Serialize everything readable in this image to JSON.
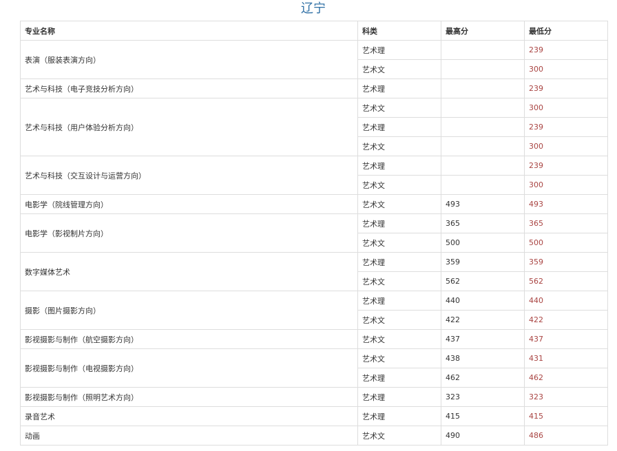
{
  "page_title": "辽宁",
  "table": {
    "headers": {
      "name": "专业名称",
      "category": "科类",
      "max": "最高分",
      "min": "最低分"
    },
    "rows": [
      {
        "name": "表演（服装表演方向）",
        "rowspan": 2,
        "category": "艺术理",
        "max": "",
        "min": "239"
      },
      {
        "category": "艺术文",
        "max": "",
        "min": "300"
      },
      {
        "name": "艺术与科技（电子竞技分析方向）",
        "rowspan": 1,
        "category": "艺术理",
        "max": "",
        "min": "239"
      },
      {
        "name": "艺术与科技（用户体验分析方向）",
        "rowspan": 3,
        "category": "艺术文",
        "max": "",
        "min": "300"
      },
      {
        "category": "艺术理",
        "max": "",
        "min": "239"
      },
      {
        "category": "艺术文",
        "max": "",
        "min": "300"
      },
      {
        "name": "艺术与科技（交互设计与运营方向）",
        "rowspan": 2,
        "category": "艺术理",
        "max": "",
        "min": "239"
      },
      {
        "category": "艺术文",
        "max": "",
        "min": "300"
      },
      {
        "name": "电影学（院线管理方向）",
        "rowspan": 1,
        "category": "艺术文",
        "max": "493",
        "min": "493"
      },
      {
        "name": "电影学（影视制片方向）",
        "rowspan": 2,
        "category": "艺术理",
        "max": "365",
        "min": "365"
      },
      {
        "category": "艺术文",
        "max": "500",
        "min": "500"
      },
      {
        "name": "数字媒体艺术",
        "rowspan": 2,
        "category": "艺术理",
        "max": "359",
        "min": "359"
      },
      {
        "category": "艺术文",
        "max": "562",
        "min": "562"
      },
      {
        "name": "摄影（图片摄影方向）",
        "rowspan": 2,
        "category": "艺术理",
        "max": "440",
        "min": "440"
      },
      {
        "category": "艺术文",
        "max": "422",
        "min": "422"
      },
      {
        "name": "影视摄影与制作（航空摄影方向）",
        "rowspan": 1,
        "category": "艺术文",
        "max": "437",
        "min": "437"
      },
      {
        "name": "影视摄影与制作（电视摄影方向）",
        "rowspan": 2,
        "category": "艺术文",
        "max": "438",
        "min": "431"
      },
      {
        "category": "艺术理",
        "max": "462",
        "min": "462"
      },
      {
        "name": "影视摄影与制作（照明艺术方向）",
        "rowspan": 1,
        "category": "艺术理",
        "max": "323",
        "min": "323"
      },
      {
        "name": "录音艺术",
        "rowspan": 1,
        "category": "艺术理",
        "max": "415",
        "min": "415"
      },
      {
        "name": "动画",
        "rowspan": 1,
        "category": "艺术文",
        "max": "490",
        "min": "486"
      }
    ]
  }
}
